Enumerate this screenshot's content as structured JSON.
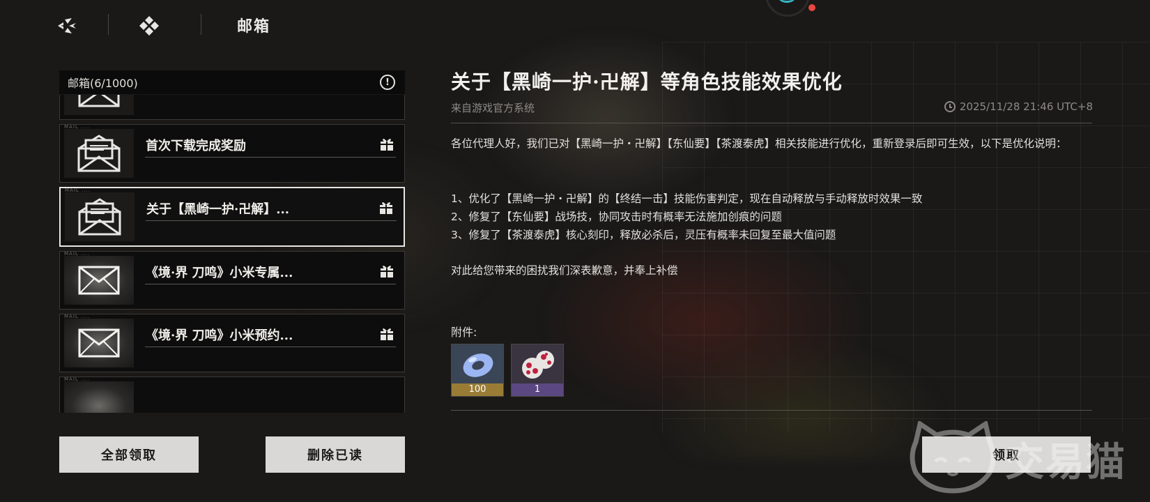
{
  "header": {
    "title": "邮箱",
    "nav_icon_1": "wings-logo-icon",
    "nav_icon_2": "diamond-cluster-icon"
  },
  "mailbox": {
    "header_label": "邮箱(6/1000)",
    "items": [
      {
        "title": "",
        "tag": "",
        "icon": "envelope-open-icon",
        "selected": false,
        "glow": false
      },
      {
        "title": "首次下载完成奖励",
        "tag": "MAIL ....",
        "icon": "envelope-open-icon",
        "selected": false,
        "glow": false
      },
      {
        "title": "关于【黑崎一护·卍解】...",
        "tag": "MAIL ....",
        "icon": "envelope-open-icon",
        "selected": true,
        "glow": false
      },
      {
        "title": "《境·界 刀鸣》小米专属...",
        "tag": "MAIL ....",
        "icon": "envelope-closed-icon",
        "selected": false,
        "glow": true
      },
      {
        "title": "《境·界 刀鸣》小米预约...",
        "tag": "MAIL ....",
        "icon": "envelope-closed-icon",
        "selected": false,
        "glow": true
      },
      {
        "title": "",
        "tag": "MAIL ....",
        "icon": "envelope-closed-icon",
        "selected": false,
        "glow": true
      }
    ],
    "claim_all_label": "全部领取",
    "delete_read_label": "删除已读"
  },
  "detail": {
    "title": "关于【黑崎一护·卍解】等角色技能效果优化",
    "sender": "来自游戏官方系统",
    "timestamp": "2025/11/28 21:46 UTC+8",
    "paragraph_1": "各位代理人好，我们已对【黑崎一护・卍解】【东仙要】【茶渡泰虎】相关技能进行优化，重新登录后即可生效，以下是优化说明：",
    "list": [
      "1、优化了【黑崎一护・卍解】的【终结一击】技能伤害判定，现在自动释放与手动释放时效果一致",
      "2、修复了【东仙要】战场技，协同攻击时有概率无法施加创痕的问题",
      "3、修复了【茶渡泰虎】核心刻印，释放必杀后，灵压有概率未回复至最大值问题"
    ],
    "closing": "对此给您带来的困扰我们深表歉意，并奉上补偿",
    "attachments_label": "附件:",
    "attachments": [
      {
        "icon": "blue-ring-icon",
        "count": "100",
        "rarity_color": "#c9a24a"
      },
      {
        "icon": "red-dice-icon",
        "count": "1",
        "rarity_color": "#7a5aa8"
      }
    ],
    "claim_label": "领取"
  },
  "watermark": {
    "text": "交易猫"
  },
  "colors": {
    "accent_teal": "#38b8c8",
    "notification_red": "#e8483f",
    "button_bg": "#d9d8d6"
  }
}
